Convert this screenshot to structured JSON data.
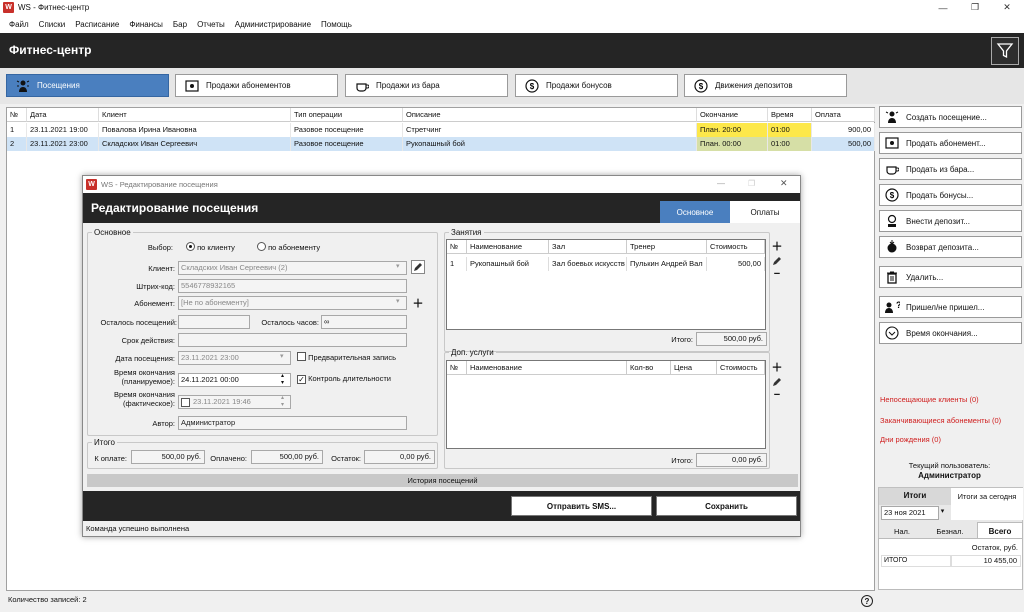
{
  "window": {
    "icon_text": "W",
    "title": "WS - Фитнес-центр",
    "minimize": "—",
    "maximize": "❐",
    "close": "✕"
  },
  "menu": [
    "Файл",
    "Списки",
    "Расписание",
    "Финансы",
    "Бар",
    "Отчеты",
    "Администрирование",
    "Помощь"
  ],
  "header": {
    "title": "Фитнес-центр"
  },
  "tabs": [
    {
      "label": "Посещения",
      "icon": "person-icon"
    },
    {
      "label": "Продажи абонементов",
      "icon": "card-icon"
    },
    {
      "label": "Продажи из бара",
      "icon": "cup-icon"
    },
    {
      "label": "Продажи бонусов",
      "icon": "dollar-icon"
    },
    {
      "label": "Движения депозитов",
      "icon": "dollar-icon"
    }
  ],
  "grid": {
    "columns": [
      "№",
      "Дата",
      "Клиент",
      "Тип операции",
      "Описание",
      "Окончание",
      "Время",
      "Оплата"
    ],
    "rows": [
      [
        "1",
        "23.11.2021 19:00",
        "Повалова Ирина Ивановна",
        "Разовое посещение",
        "Стретчинг",
        "План. 20:00",
        "01:00",
        "900,00"
      ],
      [
        "2",
        "23.11.2021 23:00",
        "Складских Иван Сергеевич",
        "Разовое посещение",
        "Рукопашный бой",
        "План. 00:00",
        "01:00",
        "500,00"
      ]
    ]
  },
  "actions": [
    {
      "label": "Создать посещение...",
      "icon": "person-icon"
    },
    {
      "label": "Продать абонемент...",
      "icon": "card-icon"
    },
    {
      "label": "Продать из бара...",
      "icon": "cup-icon"
    },
    {
      "label": "Продать бонусы...",
      "icon": "dollar-icon"
    },
    {
      "label": "Внести депозит...",
      "icon": "deposit-icon"
    },
    {
      "label": "Возврат депозита...",
      "icon": "return-icon"
    },
    {
      "label": "Удалить...",
      "icon": "trash-icon"
    },
    {
      "label": "Пришел/не пришел...",
      "icon": "question-person-icon"
    },
    {
      "label": "Время окончания...",
      "icon": "clock-icon"
    }
  ],
  "alerts": [
    "Непосещающие клиенты (0)",
    "Заканчивающиеся абонементы (0)",
    "Дни рождения (0)"
  ],
  "user": {
    "label": "Текущий пользователь:",
    "name": "Администратор"
  },
  "totals": {
    "tab_totals": "Итоги",
    "tab_today": "Итоги за сегодня",
    "date": "23 ноя  2021",
    "subtabs": [
      "Нал.",
      "Безнал.",
      "Всего"
    ],
    "col_header": "Остаток, руб.",
    "row_label": "ИТОГО",
    "row_value": "10 455,00"
  },
  "status": {
    "count": "Количество записей: 2",
    "help": "?"
  },
  "dialog": {
    "window_title": "WS - Редактирование посещения",
    "heading": "Редактирование посещения",
    "tabs": [
      "Основное",
      "Оплаты"
    ],
    "main_group": "Основное",
    "choice_label": "Выбор:",
    "choice_client": "по клиенту",
    "choice_membership": "по абонементу",
    "client_label": "Клиент:",
    "client_value": "Складских Иван Сергеевич (2)",
    "barcode_label": "Штрих-код:",
    "barcode_value": "5546778932165",
    "membership_label": "Абонемент:",
    "membership_value": "[Не по абонементу]",
    "visits_left_label": "Осталось посещений:",
    "hours_left_label": "Осталось часов:",
    "hours_left_value": "∞",
    "validity_label": "Срок действия:",
    "visit_date_label": "Дата посещения:",
    "visit_date_value": "23.11.2021 23:00",
    "prebook_label": "Предварительная запись",
    "end_planned_label": "Время окончания (планируемое):",
    "end_planned_value": "24.11.2021 00:00",
    "duration_control_label": "Контроль длительности",
    "end_actual_label": "Время окончания (фактическое):",
    "end_actual_value": "23.11.2021 19:46",
    "author_label": "Автор:",
    "author_value": "Администратор",
    "totals_group": "Итого",
    "to_pay_label": "К оплате:",
    "to_pay_value": "500,00 руб.",
    "paid_label": "Оплачено:",
    "paid_value": "500,00 руб.",
    "balance_label": "Остаток:",
    "balance_value": "0,00 руб.",
    "classes_group": "Занятия",
    "classes_columns": [
      "№",
      "Наименование",
      "Зал",
      "Тренер",
      "Стоимость"
    ],
    "classes_rows": [
      [
        "1",
        "Рукопашный бой",
        "Зал боевых искусств",
        "Пулькин Андрей Вал",
        "500,00"
      ]
    ],
    "classes_total_label": "Итого:",
    "classes_total_value": "500,00 руб.",
    "services_group": "Доп. услуги",
    "services_columns": [
      "№",
      "Наименование",
      "Кол-во",
      "Цена",
      "Стоимость"
    ],
    "services_total_label": "Итого:",
    "services_total_value": "0,00 руб.",
    "history_bar": "История посещений",
    "send_sms": "Отправить SMS...",
    "save": "Сохранить",
    "status": "Команда успешно выполнена"
  }
}
